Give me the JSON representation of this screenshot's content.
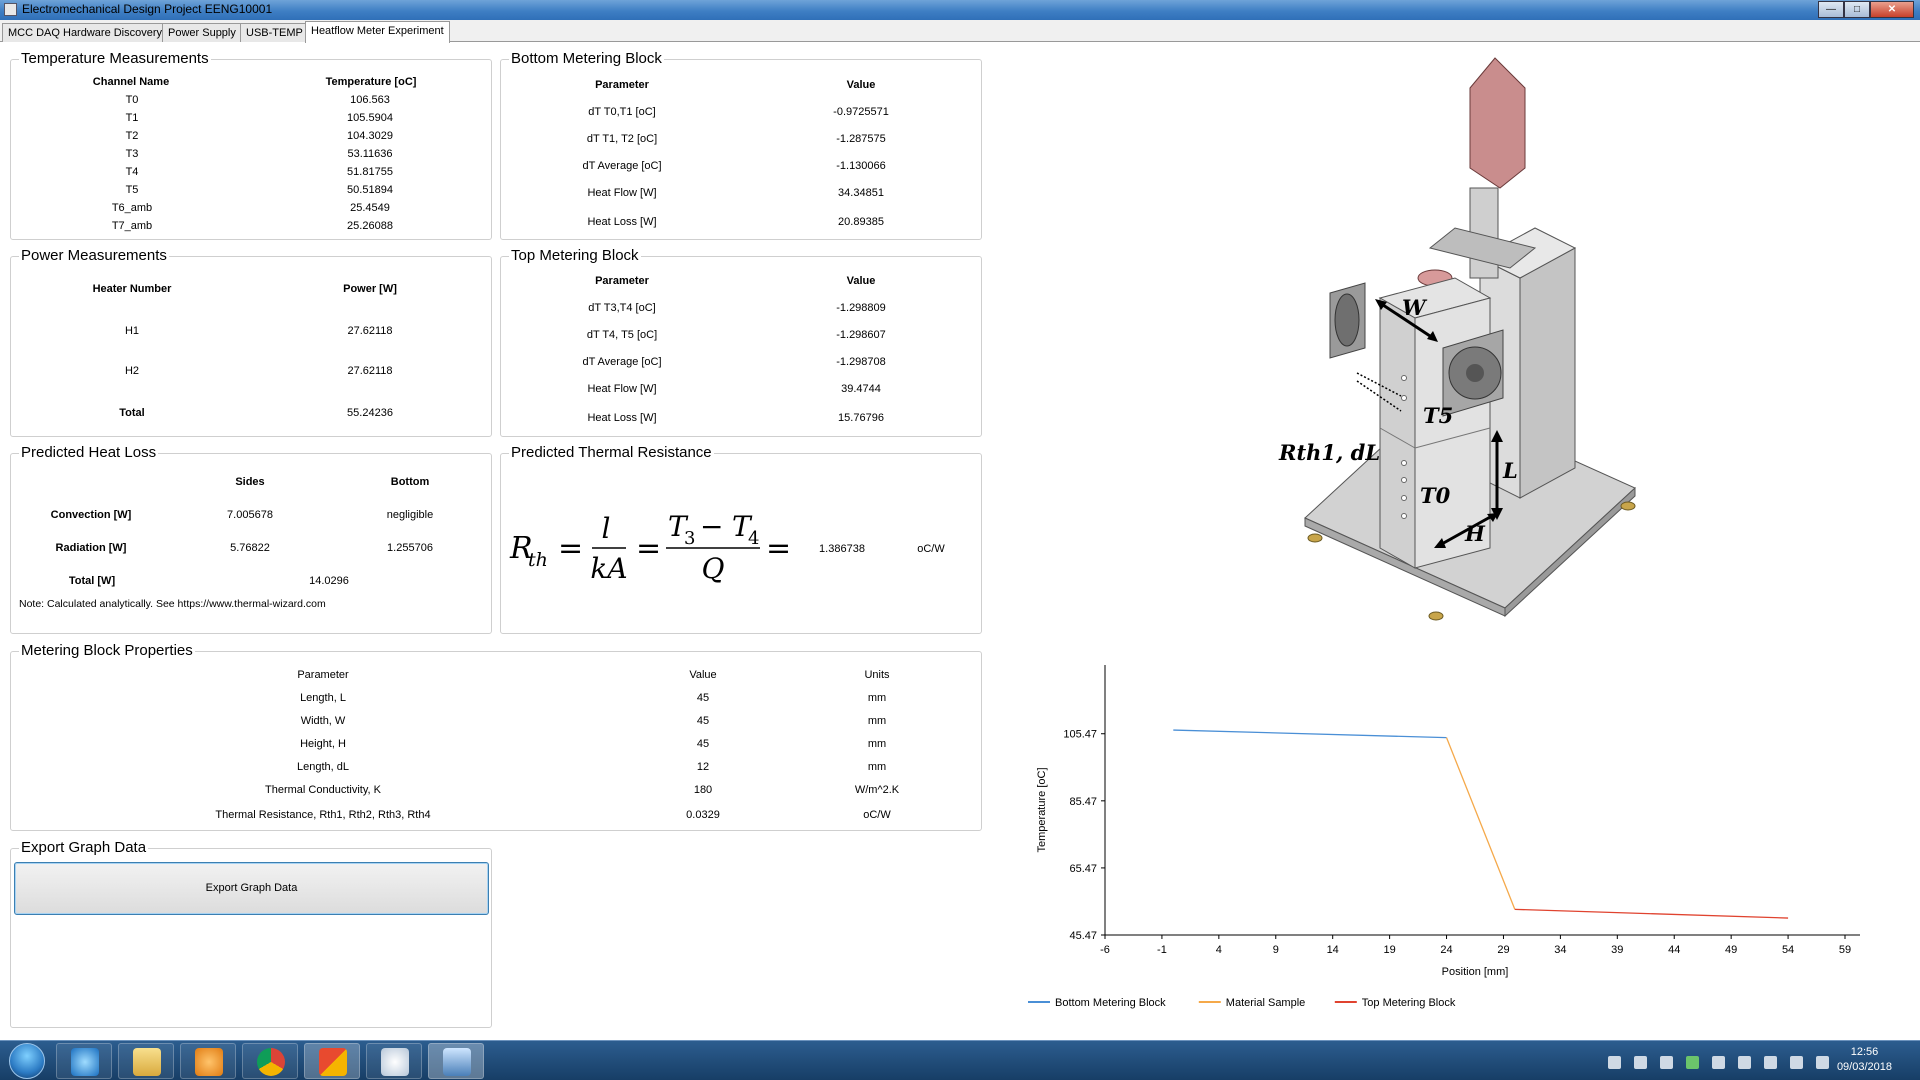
{
  "window": {
    "title": "Electromechanical Design Project EENG10001"
  },
  "tabs": [
    {
      "label": "MCC DAQ Hardware Discovery"
    },
    {
      "label": "Power Supply"
    },
    {
      "label": "USB-TEMP"
    },
    {
      "label": "Heatflow Meter Experiment"
    }
  ],
  "temperature": {
    "title": "Temperature Measurements",
    "col1": "Channel Name",
    "col2": "Temperature [oC]",
    "rows": [
      {
        "name": "T0",
        "value": "106.563"
      },
      {
        "name": "T1",
        "value": "105.5904"
      },
      {
        "name": "T2",
        "value": "104.3029"
      },
      {
        "name": "T3",
        "value": "53.11636"
      },
      {
        "name": "T4",
        "value": "51.81755"
      },
      {
        "name": "T5",
        "value": "50.51894"
      },
      {
        "name": "T6_amb",
        "value": "25.4549"
      },
      {
        "name": "T7_amb",
        "value": "25.26088"
      }
    ]
  },
  "bottom_block": {
    "title": "Bottom Metering Block",
    "col1": "Parameter",
    "col2": "Value",
    "rows": [
      {
        "name": "dT T0,T1 [oC]",
        "value": "-0.9725571"
      },
      {
        "name": "dT T1, T2  [oC]",
        "value": "-1.287575"
      },
      {
        "name": "dT Average  [oC]",
        "value": "-1.130066"
      },
      {
        "name": "Heat Flow [W]",
        "value": "34.34851"
      },
      {
        "name": "Heat Loss [W]",
        "value": "20.89385"
      }
    ]
  },
  "power": {
    "title": "Power Measurements",
    "col1": "Heater Number",
    "col2": "Power [W]",
    "rows": [
      {
        "name": "H1",
        "value": "27.62118"
      },
      {
        "name": "H2",
        "value": "27.62118"
      }
    ],
    "total_label": "Total",
    "total_value": "55.24236"
  },
  "top_block": {
    "title": "Top Metering Block",
    "col1": "Parameter",
    "col2": "Value",
    "rows": [
      {
        "name": "dT T3,T4  [oC]",
        "value": "-1.298809"
      },
      {
        "name": "dT T4, T5  [oC]",
        "value": "-1.298607"
      },
      {
        "name": "dT Average  [oC]",
        "value": "-1.298708"
      },
      {
        "name": "Heat Flow [W]",
        "value": "39.4744"
      },
      {
        "name": "Heat Loss [W]",
        "value": "15.76796"
      }
    ]
  },
  "heat_loss": {
    "title": "Predicted Heat Loss",
    "col_sides": "Sides",
    "col_bottom": "Bottom",
    "convection_label": "Convection  [W]",
    "convection_sides": "7.005678",
    "convection_bottom": "negligible",
    "radiation_label": "Radiation  [W]",
    "radiation_sides": "5.76822",
    "radiation_bottom": "1.255706",
    "total_label": "Total  [W]",
    "total_value": "14.0296",
    "note": "Note: Calculated analytically. See https://www.thermal-wizard.com"
  },
  "thermal_resistance": {
    "title": "Predicted Thermal Resistance",
    "value": "1.386738",
    "unit": "oC/W"
  },
  "properties": {
    "title": "Metering Block Properties",
    "col1": "Parameter",
    "col2": "Value",
    "col3": "Units",
    "rows": [
      {
        "name": "Length, L",
        "value": "45",
        "unit": "mm"
      },
      {
        "name": "Width, W",
        "value": "45",
        "unit": "mm"
      },
      {
        "name": "Height, H",
        "value": "45",
        "unit": "mm"
      },
      {
        "name": "Length, dL",
        "value": "12",
        "unit": "mm"
      },
      {
        "name": "Thermal Conductivity, K",
        "value": "180",
        "unit": "W/m^2.K"
      },
      {
        "name": "Thermal Resistance, Rth1, Rth2, Rth3, Rth4",
        "value": "0.0329",
        "unit": "oC/W"
      }
    ]
  },
  "export": {
    "title": "Export Graph Data",
    "button_label": "Export Graph Data"
  },
  "diagram": {
    "labels": {
      "W": "W",
      "T5": "T5",
      "rth": "Rth1, dL",
      "L": "L",
      "T0": "T0",
      "H": "H"
    }
  },
  "chart_data": {
    "type": "line",
    "xlabel": "Position [mm]",
    "ylabel": "Temperature [oC]",
    "xlim": [
      -6,
      59
    ],
    "ylim": [
      45.47,
      120
    ],
    "xticks": [
      -6,
      -1,
      4,
      9,
      14,
      19,
      24,
      29,
      34,
      39,
      44,
      49,
      54,
      59
    ],
    "yticks": [
      45.47,
      65.47,
      85.47,
      105.47
    ],
    "legend_position": "bottom",
    "series": [
      {
        "name": "Bottom Metering Block",
        "color": "#4a8fd6",
        "x": [
          0,
          24
        ],
        "y": [
          106.563,
          104.3029
        ]
      },
      {
        "name": "Material Sample",
        "color": "#f5a94a",
        "x": [
          24,
          30
        ],
        "y": [
          104.3029,
          53.11636
        ]
      },
      {
        "name": "Top Metering Block",
        "color": "#e0432f",
        "x": [
          30,
          54
        ],
        "y": [
          53.11636,
          50.51894
        ]
      }
    ]
  },
  "taskbar": {
    "time": "12:56",
    "date": "09/03/2018"
  }
}
